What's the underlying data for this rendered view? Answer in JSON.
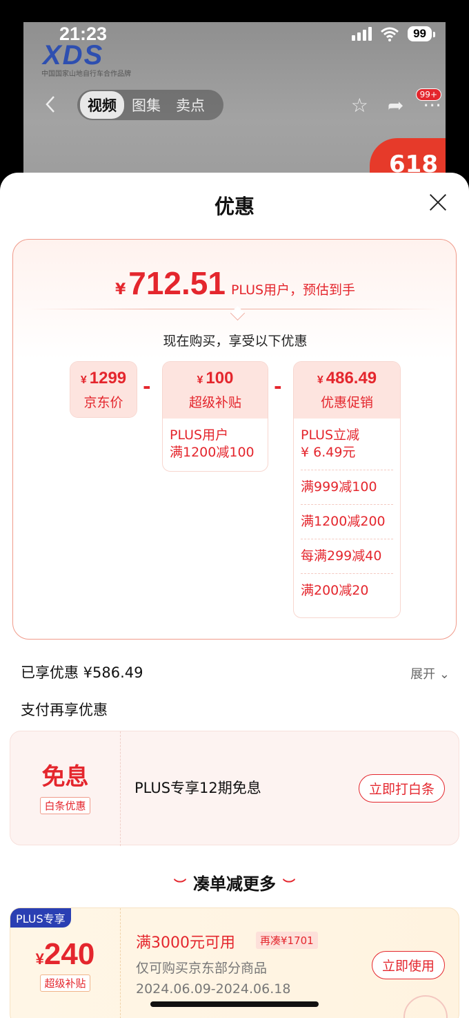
{
  "status_bar": {
    "time": "21:23",
    "battery": "99"
  },
  "product_header": {
    "brand": "XDS",
    "brand_subtitle": "中国国家山地自行车合作品牌",
    "media_tabs": [
      "视频",
      "图集",
      "卖点"
    ],
    "badge": "99+",
    "promo": "618"
  },
  "sheet": {
    "title": "优惠"
  },
  "final_price": {
    "currency": "¥",
    "amount": "712.51",
    "note": "PLUS用户，预估到手"
  },
  "buy_now_text": "现在购买，享受以下优惠",
  "breakdown": {
    "jd_price": {
      "currency": "¥",
      "amount": "1299",
      "label": "京东价"
    },
    "subsidy": {
      "currency": "¥",
      "amount": "100",
      "label": "超级补贴",
      "rows": [
        "PLUS用户\n满1200减100"
      ]
    },
    "promotion": {
      "currency": "¥",
      "amount": "486.49",
      "label": "优惠促销",
      "rows": [
        "PLUS立减\n¥ 6.49元",
        "满999减100",
        "满1200减200",
        "每满299减40",
        "满200减20"
      ]
    },
    "minus_sign": "-"
  },
  "savings": {
    "text": "已享优惠 ¥586.49",
    "expand": "展开"
  },
  "pay_more": "支付再享优惠",
  "interest_free": {
    "title": "免息",
    "tag": "白条优惠",
    "text": "PLUS专享12期免息",
    "button": "立即打白条"
  },
  "more_section": {
    "title": "凑单减更多"
  },
  "coupon": {
    "plus_tag": "PLUS专享",
    "currency": "¥",
    "amount": "240",
    "tag": "超级补贴",
    "condition": "满3000元可用",
    "need_more": "再凑¥1701",
    "scope": "仅可购买京东部分商品",
    "date_range": "2024.06.09-2024.06.18",
    "button": "立即使用"
  },
  "colors": {
    "accent": "#e4262d",
    "plus_blue": "#2a3fb3"
  }
}
